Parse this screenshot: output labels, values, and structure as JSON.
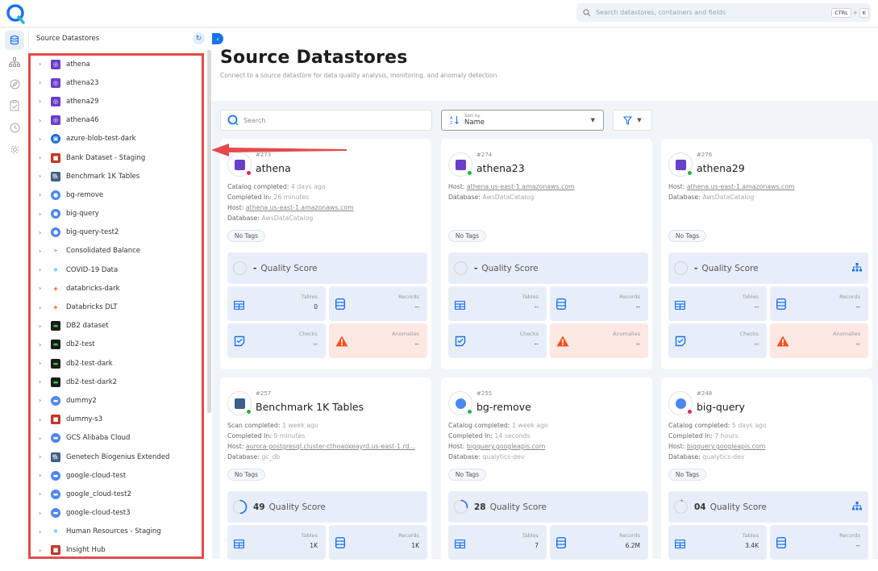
{
  "header": {
    "search_placeholder": "Search datastores, containers and fields",
    "shortcut_key1": "CTRL",
    "shortcut_plus": "+",
    "shortcut_key2": "K"
  },
  "rail": {
    "items": [
      {
        "icon": "database-icon",
        "active": true
      },
      {
        "icon": "hierarchy-icon",
        "active": false
      },
      {
        "icon": "compass-icon",
        "active": false
      },
      {
        "icon": "clipboard-check-icon",
        "active": false
      },
      {
        "icon": "clock-icon",
        "active": false
      },
      {
        "icon": "gear-icon",
        "active": false
      }
    ]
  },
  "tree": {
    "title": "Source Datastores",
    "items": [
      {
        "label": "athena",
        "icon": "athena"
      },
      {
        "label": "athena23",
        "icon": "athena"
      },
      {
        "label": "athena29",
        "icon": "athena"
      },
      {
        "label": "athena46",
        "icon": "athena"
      },
      {
        "label": "azure-blob-test-dark",
        "icon": "azure"
      },
      {
        "label": "Bank Dataset - Staging",
        "icon": "s3"
      },
      {
        "label": "Benchmark 1K Tables",
        "icon": "postgres"
      },
      {
        "label": "bg-remove",
        "icon": "bigquery"
      },
      {
        "label": "big-query",
        "icon": "bigquery"
      },
      {
        "label": "big-query-test2",
        "icon": "bigquery"
      },
      {
        "label": "Consolidated Balance",
        "icon": "oracle"
      },
      {
        "label": "COVID-19 Data",
        "icon": "snowflake"
      },
      {
        "label": "databricks-dark",
        "icon": "databricks"
      },
      {
        "label": "Databricks DLT",
        "icon": "databricks"
      },
      {
        "label": "DB2 dataset",
        "icon": "db2"
      },
      {
        "label": "db2-test",
        "icon": "db2"
      },
      {
        "label": "db2-test-dark",
        "icon": "db2"
      },
      {
        "label": "db2-test-dark2",
        "icon": "db2"
      },
      {
        "label": "dummy2",
        "icon": "gcs"
      },
      {
        "label": "dummy-s3",
        "icon": "s3"
      },
      {
        "label": "GCS Alibaba Cloud",
        "icon": "gcs"
      },
      {
        "label": "Genetech Biogenius Extended",
        "icon": "postgres"
      },
      {
        "label": "google-cloud-test",
        "icon": "gcs"
      },
      {
        "label": "google_cloud-test2",
        "icon": "gcs"
      },
      {
        "label": "google-cloud-test3",
        "icon": "gcs"
      },
      {
        "label": "Human Resources - Staging",
        "icon": "snowflake"
      },
      {
        "label": "Insight Hub",
        "icon": "s3"
      }
    ]
  },
  "main": {
    "title": "Source Datastores",
    "subtitle": "Connect to a source datastore for data quality analysis, monitoring, and anomaly detection",
    "search_placeholder": "Search",
    "sort_label": "Sort by",
    "sort_value": "Name",
    "labels": {
      "host": "Host:",
      "database": "Database:",
      "completed_in": "Completed In:",
      "no_tags": "No Tags",
      "quality_score": "Quality Score",
      "tables": "Tables",
      "records": "Records",
      "checks": "Checks",
      "anomalies": "Anomalies"
    },
    "cards": [
      {
        "id": "#273",
        "name": "athena",
        "icon": "athena",
        "status": "error",
        "op_label": "Catalog completed:",
        "op_value": "4 days ago",
        "completed_in": "26 minutes",
        "host": "athena.us-east-1.amazonaws.com",
        "database": "AwsDataCatalog",
        "score": "-",
        "score_pct": 0,
        "tables": "0",
        "records": "--",
        "checks": "--",
        "anomalies": "--",
        "show_tree": false
      },
      {
        "id": "#274",
        "name": "athena23",
        "icon": "athena",
        "status": "ok",
        "op_label": "",
        "op_value": "",
        "completed_in": "",
        "host": "athena.us-east-1.amazonaws.com",
        "database": "AwsDataCatalog",
        "score": "-",
        "score_pct": 0,
        "tables": "--",
        "records": "--",
        "checks": "--",
        "anomalies": "--",
        "show_tree": false
      },
      {
        "id": "#276",
        "name": "athena29",
        "icon": "athena",
        "status": "ok",
        "op_label": "",
        "op_value": "",
        "completed_in": "",
        "host": "athena.us-east-1.amazonaws.com",
        "database": "AwsDataCatalog",
        "score": "-",
        "score_pct": 0,
        "tables": "--",
        "records": "--",
        "checks": "--",
        "anomalies": "--",
        "show_tree": true
      },
      {
        "id": "#257",
        "name": "Benchmark 1K Tables",
        "icon": "postgres",
        "status": "ok",
        "op_label": "Scan completed:",
        "op_value": "1 week ago",
        "completed_in": "9 minutes",
        "host": "aurora-postgresql.cluster-cthoaoxeayrd.us-east-1.rd...",
        "database": "gc_db",
        "score": "49",
        "score_pct": 49,
        "tables": "1K",
        "records": "1K",
        "show_tree": false
      },
      {
        "id": "#255",
        "name": "bg-remove",
        "icon": "bigquery",
        "status": "ok",
        "op_label": "Catalog completed:",
        "op_value": "1 week ago",
        "completed_in": "14 seconds",
        "host": "bigquery.googleapis.com",
        "database": "qualytics-dev",
        "score": "28",
        "score_pct": 28,
        "tables": "7",
        "records": "6.2M",
        "show_tree": false
      },
      {
        "id": "#248",
        "name": "big-query",
        "icon": "bigquery",
        "status": "error",
        "op_label": "Catalog completed:",
        "op_value": "5 days ago",
        "completed_in": "7 hours",
        "host": "bigquery.googleapis.com",
        "database": "qualytics-dev",
        "score": "04",
        "score_pct": 4,
        "tables": "3.4K",
        "records": "--",
        "show_tree": true
      }
    ]
  },
  "colors": {
    "accent": "#1a73e8",
    "status_ok": "#22b14c",
    "status_error": "#e0245e",
    "highlight": "#e44b4b",
    "anomaly": "#f4511e"
  }
}
